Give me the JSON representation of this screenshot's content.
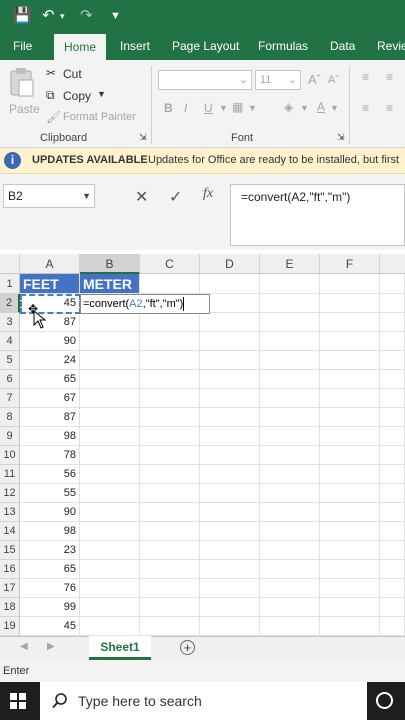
{
  "tabs": [
    "File",
    "Home",
    "Insert",
    "Page Layout",
    "Formulas",
    "Data",
    "Revie"
  ],
  "clipboard": {
    "paste": "Paste",
    "cut": "Cut",
    "copy": "Copy",
    "format_painter": "Format Painter",
    "group_label": "Clipboard"
  },
  "font": {
    "size": "11",
    "group_label": "Font",
    "bold": "B",
    "italic": "I",
    "underline": "U"
  },
  "message_bar": {
    "title": "UPDATES AVAILABLE",
    "text": "Updates for Office are ready to be installed, but first"
  },
  "name_box": "B2",
  "formula": "=convert(A2,\"ft\",\"m\")",
  "grid": {
    "columns": [
      "A",
      "B",
      "C",
      "D",
      "E",
      "F"
    ],
    "header_row": {
      "a": "FEET",
      "b": "METER"
    },
    "editing": {
      "prefix": "=convert(",
      "ref": "A2",
      "suffix": ",\"ft\",\"m\")"
    },
    "rows": [
      {
        "n": "1"
      },
      {
        "n": "2",
        "a": "45"
      },
      {
        "n": "3",
        "a": "87"
      },
      {
        "n": "4",
        "a": "90"
      },
      {
        "n": "5",
        "a": "24"
      },
      {
        "n": "6",
        "a": "65"
      },
      {
        "n": "7",
        "a": "67"
      },
      {
        "n": "8",
        "a": "87"
      },
      {
        "n": "9",
        "a": "98"
      },
      {
        "n": "10",
        "a": "78"
      },
      {
        "n": "11",
        "a": "56"
      },
      {
        "n": "12",
        "a": "55"
      },
      {
        "n": "13",
        "a": "90"
      },
      {
        "n": "14",
        "a": "98"
      },
      {
        "n": "15",
        "a": "23"
      },
      {
        "n": "16",
        "a": "65"
      },
      {
        "n": "17",
        "a": "76"
      },
      {
        "n": "18",
        "a": "99"
      },
      {
        "n": "19",
        "a": "45"
      }
    ]
  },
  "sheet_tab": "Sheet1",
  "status": "Enter",
  "taskbar": {
    "search_placeholder": "Type here to search"
  },
  "colors": {
    "accent": "#217346",
    "header_fill": "#4472c4",
    "ref_blue": "#4a7ebb"
  }
}
